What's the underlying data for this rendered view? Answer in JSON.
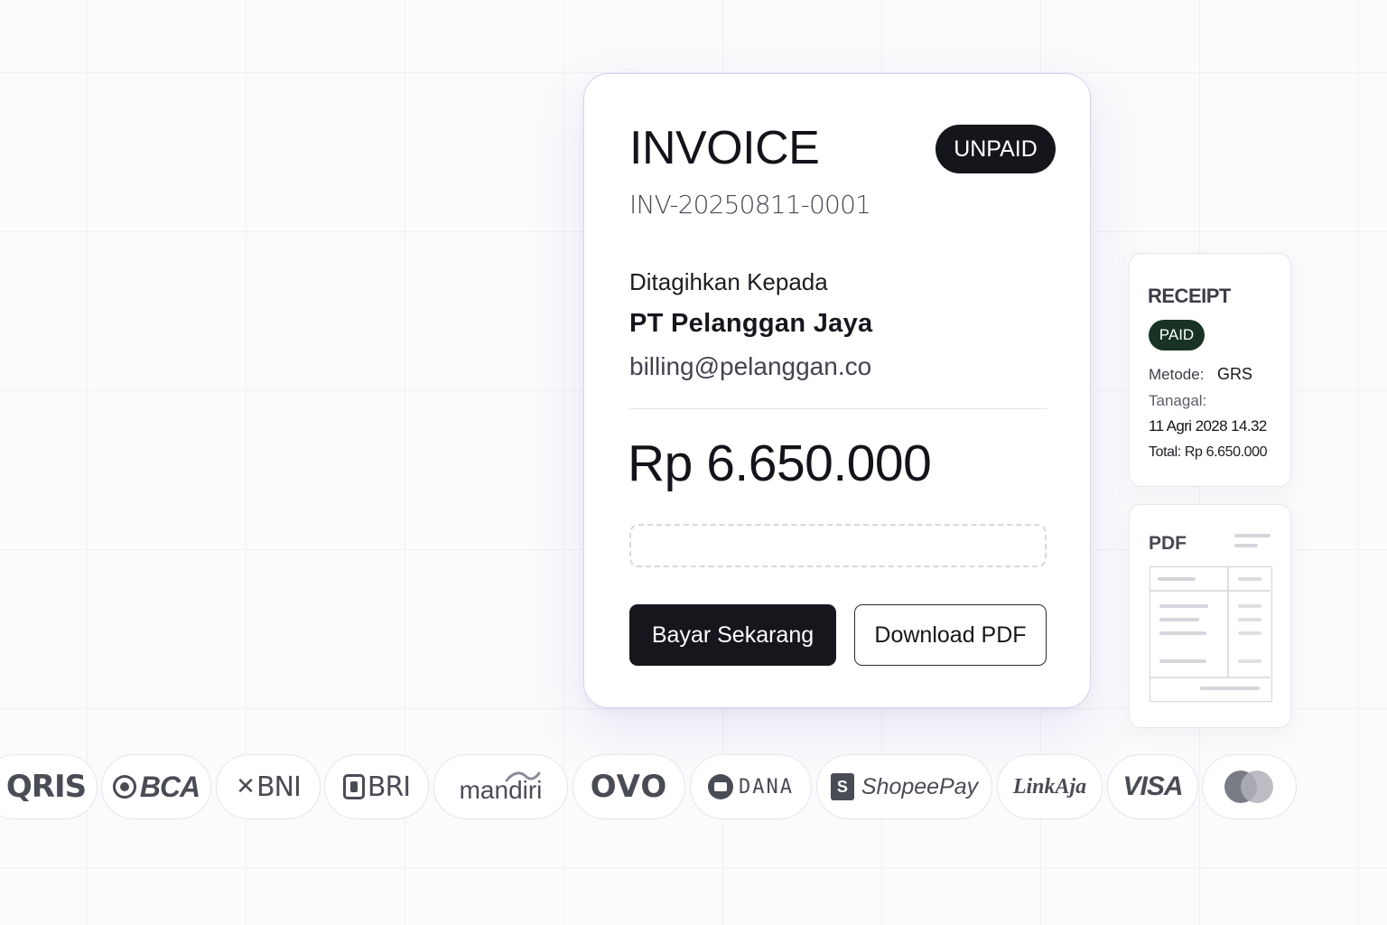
{
  "invoice": {
    "title": "INVOICE",
    "status": "UNPAID",
    "number": "INV-20250811-0001",
    "billed_to_label": "Ditagihkan Kepada",
    "customer_name": "PT Pelanggan Jaya",
    "customer_email": "billing@pelanggan.co",
    "amount": "Rp 6.650.000",
    "note_value": "",
    "pay_button": "Bayar Sekarang",
    "download_button": "Download PDF"
  },
  "receipt": {
    "title": "RECEIPT",
    "status": "PAID",
    "method_label": "Metode:",
    "method_value": "GRS",
    "date_label": "Tanagal:",
    "date_value": "11 Agri 2028 14.32",
    "total": "Total: Rp 6.650.000"
  },
  "pdf_preview": {
    "title": "PDF"
  },
  "payment_methods": [
    {
      "label": "QRIS",
      "icon": "qris-logo"
    },
    {
      "label": "BCA",
      "icon": "bca-logo"
    },
    {
      "label": "BNI",
      "icon": "bni-logo"
    },
    {
      "label": "BRI",
      "icon": "bri-logo"
    },
    {
      "label": "mandiri",
      "icon": "mandiri-logo"
    },
    {
      "label": "OVO",
      "icon": "ovo-logo"
    },
    {
      "label": "DANA",
      "icon": "dana-logo"
    },
    {
      "label": "ShopeePay",
      "icon": "shopeepay-logo"
    },
    {
      "label": "LinkAja",
      "icon": "linkaja-logo"
    },
    {
      "label": "VISA",
      "icon": "visa-logo"
    },
    {
      "label": "",
      "icon": "mastercard-logo"
    }
  ],
  "colors": {
    "primary_dark": "#15171c",
    "paid_badge": "#183325",
    "card_border": "#d6d0f2",
    "logo_gray": "#4a4c55"
  }
}
